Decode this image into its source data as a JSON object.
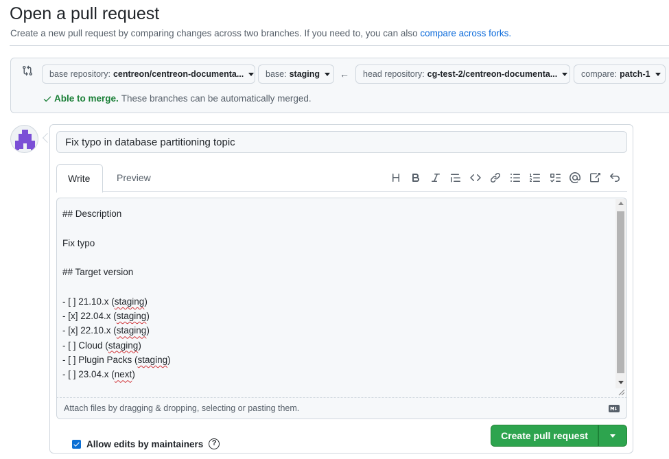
{
  "header": {
    "title": "Open a pull request",
    "subtitle": "Create a new pull request by comparing changes across two branches. If you need to, you can also",
    "compare_forks_link": "compare across forks."
  },
  "compare": {
    "base_repo_label": "base repository:",
    "base_repo_value": "centreon/centreon-documenta...",
    "base_label": "base:",
    "base_value": "staging",
    "arrow": "←",
    "head_repo_label": "head repository:",
    "head_repo_value": "cg-test-2/centreon-documenta...",
    "compare_label": "compare:",
    "compare_value": "patch-1",
    "merge_ok": "Able to merge.",
    "merge_msg": "These branches can be automatically merged."
  },
  "composer": {
    "title_value": "Fix typo in database partitioning topic",
    "tabs": [
      "Write",
      "Preview"
    ],
    "toolbar": [
      "heading-icon",
      "bold-icon",
      "italic-icon",
      "quote-icon",
      "code-icon",
      "link-icon",
      "unordered-list-icon",
      "ordered-list-icon",
      "task-list-icon",
      "mention-icon",
      "reference-icon",
      "undo-icon"
    ],
    "body": {
      "l1": "## Description",
      "l2": "Fix typo",
      "l3": "## Target version",
      "items": [
        {
          "prefix": "- [ ] 21.10.x (",
          "tag": "staging",
          "suffix": ")"
        },
        {
          "prefix": "- [x] 22.04.x (",
          "tag": "staging",
          "suffix": ")"
        },
        {
          "prefix": "- [x] 22.10.x (",
          "tag": "staging",
          "suffix": ")"
        },
        {
          "prefix": "- [ ] Cloud (",
          "tag": "staging",
          "suffix": ")"
        },
        {
          "prefix": "- [ ] Plugin Packs (",
          "tag": "staging",
          "suffix": ")"
        },
        {
          "prefix": "- [ ] 23.04.x (",
          "tag": "next",
          "suffix": ")"
        }
      ]
    },
    "attach_hint": "Attach files by dragging & dropping, selecting or pasting them.",
    "md_badge": "M↓",
    "allow_edits_label": "Allow edits by maintainers",
    "allow_edits_checked": true,
    "help_glyph": "?",
    "create_label": "Create pull request"
  },
  "colors": {
    "accent_link": "#0969da",
    "success": "#1a7f37",
    "primary_button": "#2da44e"
  }
}
